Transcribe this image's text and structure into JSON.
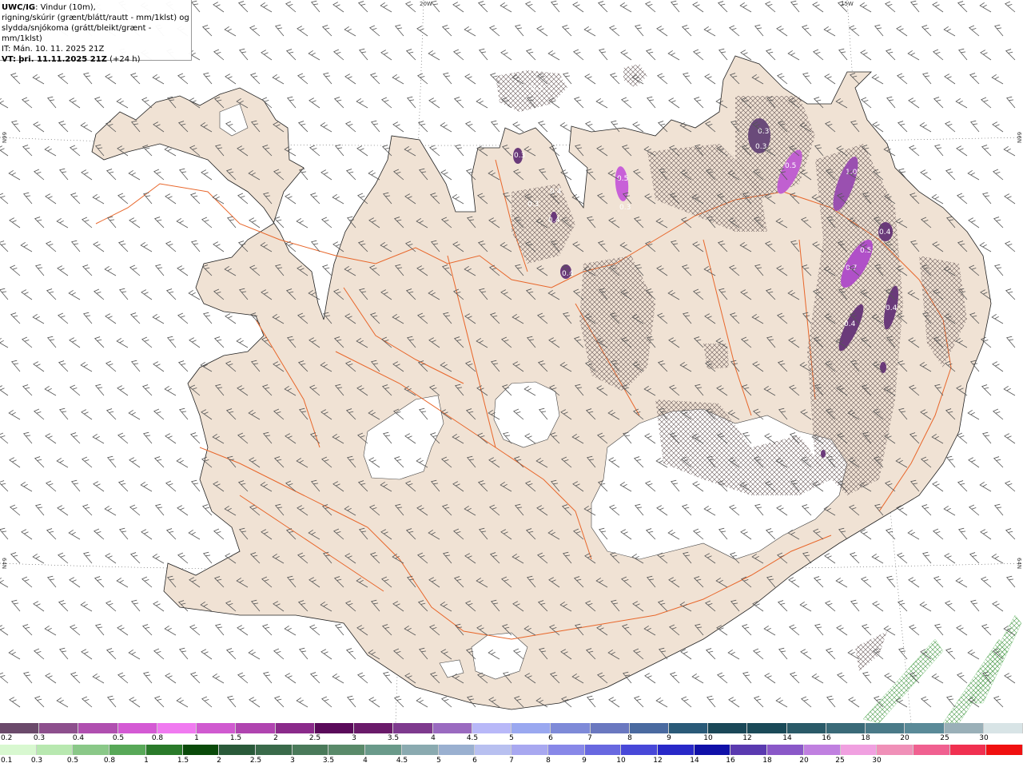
{
  "header": {
    "model": "UWC/IG",
    "line1_rest": ": Vindur (10m),",
    "line2": "rigning/skúrir (grænt/blátt/rautt - mm/1klst) og",
    "line3": "slydda/snjókoma (grátt/bleikt/grænt - mm/1klst)",
    "it_line": "IT: Mán. 10. 11. 2025 21Z",
    "vt_label": "VT:",
    "vt_rest": "þri. 11.11.2025 21Z",
    "vt_offset": "(+24 h)"
  },
  "grid_labels": {
    "lon_20w": "20W",
    "lon_15w": "15W",
    "lat_66n_left": "66N",
    "lat_66n_right": "66N",
    "lat_64n_left": "64N",
    "lat_64n_right": "64N"
  },
  "precip_labels": [
    "0.3",
    "0.3",
    "0.3",
    "0.3",
    "0.5",
    "0.5",
    "1.0",
    "0.4",
    "0.7",
    "0.5",
    "0.4",
    "0.4",
    "0.4",
    "0.3",
    "0.4",
    "0.3",
    "0.4"
  ],
  "colorbar_snow": {
    "colors": [
      "#6b4a6b",
      "#8d4f8d",
      "#b04fb0",
      "#d45ad4",
      "#f07af0",
      "#d05ad0",
      "#b044b0",
      "#8a2a8a",
      "#5a0a5a",
      "#6a1a6a",
      "#7e3a8e",
      "#9a6ac0",
      "#b8b8f8",
      "#9aa8f0",
      "#7e8ad8",
      "#6a78c0",
      "#4a6aa0",
      "#2a5a78",
      "#1a4858",
      "#1a4a58",
      "#2a5a68",
      "#3a6a78",
      "#4a7a88",
      "#5a8a98",
      "#9ab0b8",
      "#d8e4e6"
    ],
    "labels": [
      "0.2",
      "0.3",
      "0.4",
      "0.5",
      "0.8",
      "1",
      "1.5",
      "2",
      "2.5",
      "3",
      "3.5",
      "4",
      "4.5",
      "5",
      "6",
      "7",
      "8",
      "9",
      "10",
      "12",
      "14",
      "16",
      "18",
      "20",
      "25",
      "30"
    ]
  },
  "colorbar_rain": {
    "colors": [
      "#d8f8d0",
      "#b8e8b0",
      "#8ac888",
      "#58a858",
      "#2a7a2a",
      "#0a4a0a",
      "#2a5a3a",
      "#3a6a4a",
      "#4a7a5a",
      "#5a8a6a",
      "#6a9a8a",
      "#8aaab0",
      "#9ab0d0",
      "#b8c0f0",
      "#a8a8f0",
      "#8888e8",
      "#6868e0",
      "#4848d8",
      "#2828c8",
      "#1010a8",
      "#5a3ab0",
      "#8a58c8",
      "#c080e0",
      "#f0a0e0",
      "#f090b8",
      "#f06090",
      "#f03050",
      "#f01010"
    ],
    "labels": [
      "0.1",
      "0.3",
      "0.5",
      "0.8",
      "1",
      "1.5",
      "2",
      "2.5",
      "3",
      "3.5",
      "4",
      "4.5",
      "5",
      "6",
      "7",
      "8",
      "9",
      "10",
      "12",
      "14",
      "16",
      "18",
      "20",
      "25",
      "30"
    ]
  }
}
